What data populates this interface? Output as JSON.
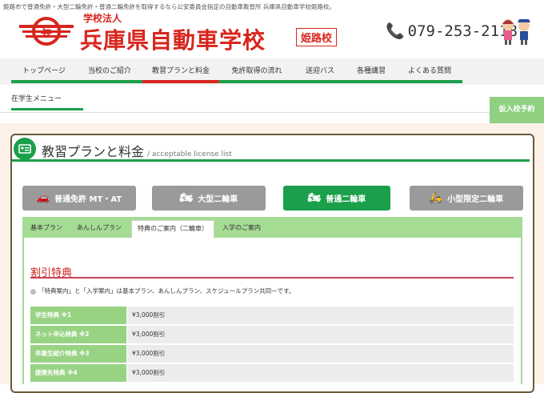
{
  "header": {
    "topline": "姫路市で普通免許・大型二輪免許・普通二輪免許を取得するなら公安委員会指定の自動車教習所 兵庫県自動車学校姫路校。",
    "school_sub": "学校法人",
    "school_name": "兵庫県自動車学校",
    "branch": "姫路校",
    "phone": "079-253-2118",
    "brand_color": "#d7261e"
  },
  "nav": {
    "items": [
      {
        "label": "トップページ"
      },
      {
        "label": "当校のご紹介"
      },
      {
        "label": "教習プランと料金"
      },
      {
        "label": "免許取得の流れ"
      },
      {
        "label": "送迎バス"
      },
      {
        "label": "各種講習"
      },
      {
        "label": "よくある質問"
      }
    ],
    "active_index": 2,
    "sub_item": "在学生メニュー",
    "enter_button": "仮入校予約"
  },
  "content": {
    "title": "教習プランと料金",
    "subtitle": "/ acceptable license list",
    "categories": [
      {
        "label": "普通免許 MT・AT",
        "icon": "car-icon",
        "color": "#9a9a9a"
      },
      {
        "label": "大型二輪車",
        "icon": "motorcycle-icon",
        "color": "#9a9a9a"
      },
      {
        "label": "普通二輪車",
        "icon": "motorcycle-icon",
        "color": "#1aa04a"
      },
      {
        "label": "小型限定二輪車",
        "icon": "scooter-icon",
        "color": "#9a9a9a"
      }
    ],
    "tabs": [
      "基本プラン",
      "あんしんプラン",
      "特典のご案内（二輪車）",
      "入学のご案内"
    ],
    "active_tab": 2,
    "section_title": "割引特典",
    "note": "「特典案内」と「入学案内」は基本プラン、あんしんプラン、スケジュールプラン共同一です。",
    "discounts": [
      {
        "label": "学生特典 ※1",
        "value": "¥3,000割引"
      },
      {
        "label": "ネット申込特典 ※2",
        "value": "¥3,000割引"
      },
      {
        "label": "卒業生紹介特典 ※3",
        "value": "¥3,000割引"
      },
      {
        "label": "提携先特典 ※4",
        "value": "¥3,000割引"
      }
    ]
  }
}
